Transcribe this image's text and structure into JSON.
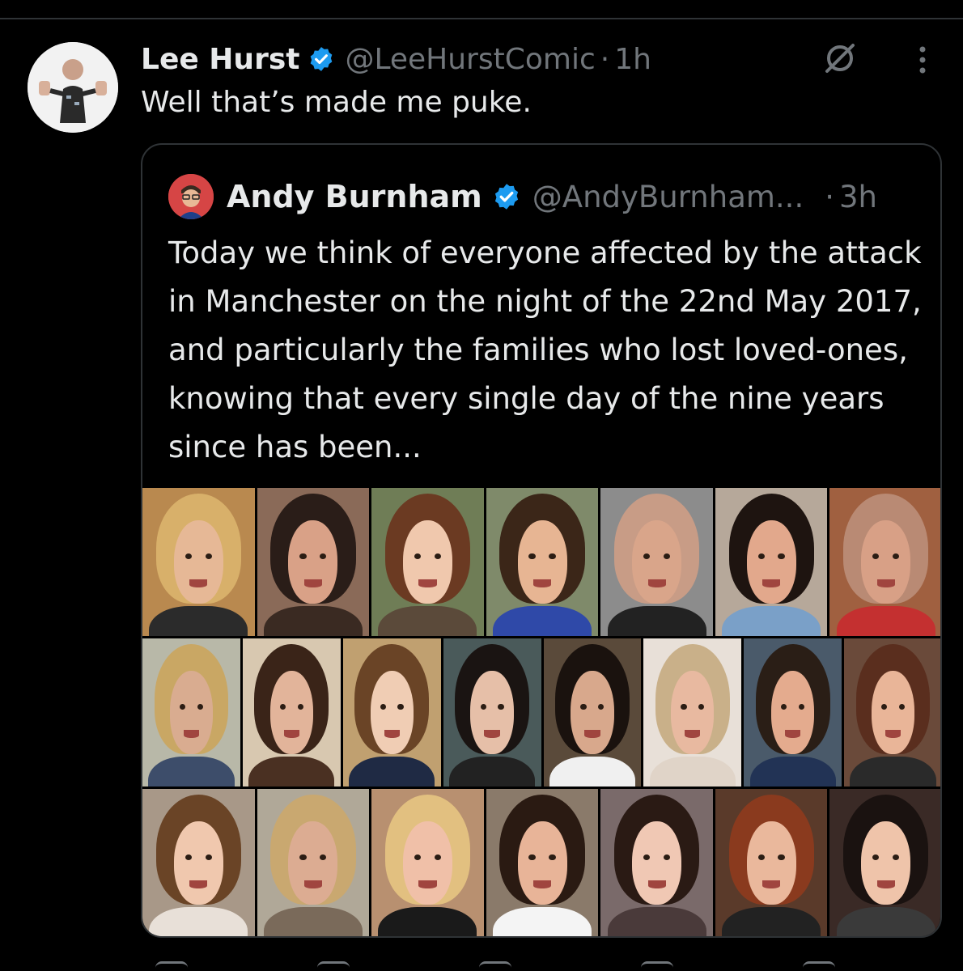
{
  "tweet": {
    "author_name": "Lee Hurst",
    "author_handle": "@LeeHurstComic",
    "separator": "·",
    "time": "1h",
    "text": "Well that’s made me puke.",
    "verified_color": "#1d9bf0"
  },
  "quoted_tweet": {
    "author_name": "Andy Burnham",
    "author_handle": "@AndyBurnham...",
    "separator": "·",
    "time": "3h",
    "text": "Today we think of everyone affected by the attack in Manchester on the night of the 22nd May 2017, and particularly the families who lost loved-ones, knowing that every single day of the nine years since has been...",
    "photo_rows": [
      [
        {
          "bg": "#b9894f",
          "hair": "#d8b06a",
          "skin": "#e6b896",
          "shirt": "#2b2b2b"
        },
        {
          "bg": "#8a6a58",
          "hair": "#2a1d18",
          "skin": "#d9a187",
          "shirt": "#3a2a22"
        },
        {
          "bg": "#6f7d56",
          "hair": "#6b3a22",
          "skin": "#f0c8ad",
          "shirt": "#5b4a3a"
        },
        {
          "bg": "#7f8a6a",
          "hair": "#3b2618",
          "skin": "#e7b593",
          "shirt": "#2f49a8"
        },
        {
          "bg": "#8c8c8c",
          "hair": "#c89c86",
          "skin": "#d9a58a",
          "shirt": "#222222"
        },
        {
          "bg": "#b6a89a",
          "hair": "#1e1410",
          "skin": "#e2a88c",
          "shirt": "#7aa0c8"
        },
        {
          "bg": "#a06040",
          "hair": "#b98a74",
          "skin": "#d8a086",
          "shirt": "#c43030"
        }
      ],
      [
        {
          "bg": "#b8b8a8",
          "hair": "#c9a764",
          "skin": "#d9ac90",
          "shirt": "#3d4d6a"
        },
        {
          "bg": "#d8c8b0",
          "hair": "#3a2418",
          "skin": "#e2b49a",
          "shirt": "#4a3022"
        },
        {
          "bg": "#c0a070",
          "hair": "#6a4426",
          "skin": "#f0cdb4",
          "shirt": "#1f2a44"
        },
        {
          "bg": "#4a5a5a",
          "hair": "#1a1412",
          "skin": "#e6bfa8",
          "shirt": "#222222"
        },
        {
          "bg": "#5a4a3a",
          "hair": "#1a120e",
          "skin": "#d8a88c",
          "shirt": "#f0f0f0"
        },
        {
          "bg": "#e8e0d8",
          "hair": "#c9b089",
          "skin": "#e8b9a0",
          "shirt": "#e0d4c8"
        },
        {
          "bg": "#4a5a6a",
          "hair": "#2a1e16",
          "skin": "#e4ab8e",
          "shirt": "#223355"
        },
        {
          "bg": "#6a4a3a",
          "hair": "#5a2e1e",
          "skin": "#e9b598",
          "shirt": "#2a2a2a"
        }
      ],
      [
        {
          "bg": "#a89888",
          "hair": "#6a4426",
          "skin": "#f0c8ae",
          "shirt": "#e8e0d8"
        },
        {
          "bg": "#b0a898",
          "hair": "#c9a870",
          "skin": "#dcac92",
          "shirt": "#7a6a5a"
        },
        {
          "bg": "#b89070",
          "hair": "#e2c080",
          "skin": "#f0c0a8",
          "shirt": "#1a1a1a"
        },
        {
          "bg": "#8a7a6a",
          "hair": "#2a1a12",
          "skin": "#e8b498",
          "shirt": "#f4f4f4"
        },
        {
          "bg": "#7a6a6a",
          "hair": "#2a1a14",
          "skin": "#f0c8b4",
          "shirt": "#4a3a3a"
        },
        {
          "bg": "#5a3a2a",
          "hair": "#8a3a1e",
          "skin": "#eab89c",
          "shirt": "#222222"
        },
        {
          "bg": "#3a2a26",
          "hair": "#1a1210",
          "skin": "#efc4aa",
          "shirt": "#3a3a3a"
        }
      ]
    ]
  },
  "icons": {
    "verified": "verified-badge-icon",
    "grok": "grok-icon",
    "more": "more-options-icon"
  }
}
